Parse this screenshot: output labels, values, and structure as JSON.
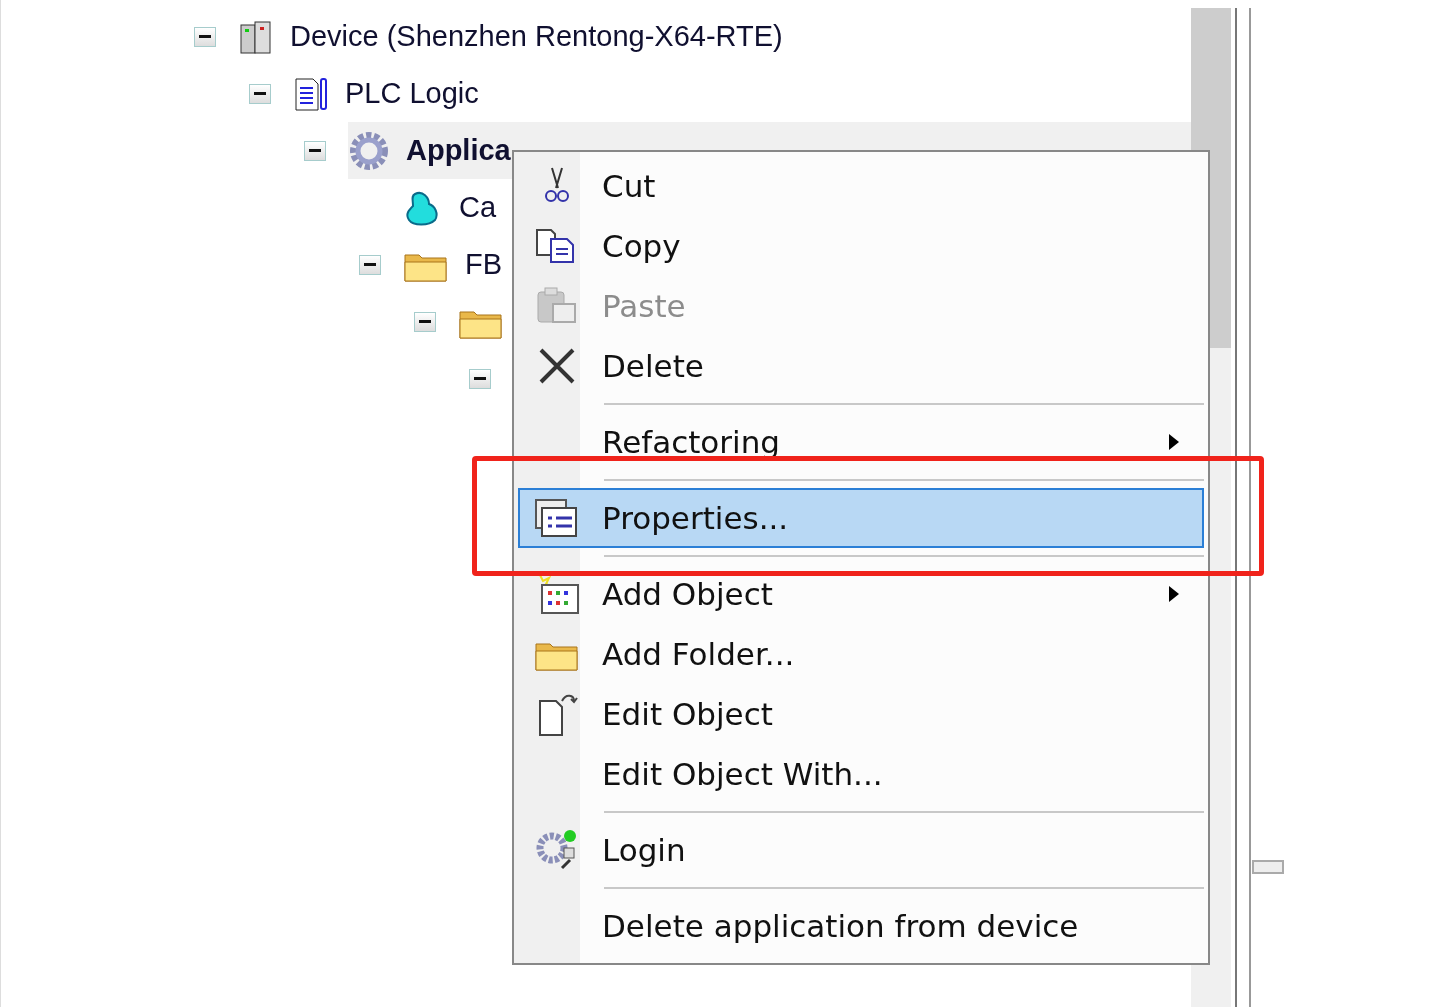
{
  "tree": [
    {
      "label": "Device (Shenzhen Rentong-X64-RTE)",
      "expanded": true,
      "selected": false,
      "children": [
        {
          "label": "PLC Logic",
          "expanded": true,
          "selected": false,
          "children": [
            {
              "label": "Applica",
              "expanded": true,
              "selected": true,
              "children": [
                {
                  "label": "Ca",
                  "selected": false
                },
                {
                  "label": "FB",
                  "expanded": true,
                  "selected": false,
                  "children": [
                    {
                      "expanded": true,
                      "selected": false,
                      "children": [
                        {
                          "expanded": true,
                          "selected": false
                        }
                      ]
                    }
                  ]
                }
              ]
            }
          ]
        }
      ]
    }
  ],
  "context_menu": {
    "items": [
      {
        "kind": "item",
        "label": "Cut",
        "disabled": false,
        "selected": false,
        "submenu": false
      },
      {
        "kind": "item",
        "label": "Copy",
        "disabled": false,
        "selected": false,
        "submenu": false
      },
      {
        "kind": "item",
        "label": "Paste",
        "disabled": true,
        "selected": false,
        "submenu": false
      },
      {
        "kind": "item",
        "label": "Delete",
        "disabled": false,
        "selected": false,
        "submenu": false
      },
      {
        "kind": "separator"
      },
      {
        "kind": "item",
        "label": "Refactoring",
        "disabled": false,
        "selected": false,
        "submenu": true
      },
      {
        "kind": "separator"
      },
      {
        "kind": "item",
        "label": "Properties...",
        "disabled": false,
        "selected": true,
        "submenu": false
      },
      {
        "kind": "separator"
      },
      {
        "kind": "item",
        "label": "Add Object",
        "disabled": false,
        "selected": false,
        "submenu": true
      },
      {
        "kind": "item",
        "label": "Add Folder...",
        "disabled": false,
        "selected": false,
        "submenu": false
      },
      {
        "kind": "item",
        "label": "Edit Object",
        "disabled": false,
        "selected": false,
        "submenu": false
      },
      {
        "kind": "item",
        "label": "Edit Object With...",
        "disabled": false,
        "selected": false,
        "submenu": false
      },
      {
        "kind": "separator"
      },
      {
        "kind": "item",
        "label": "Login",
        "disabled": false,
        "selected": false,
        "submenu": false
      },
      {
        "kind": "separator"
      },
      {
        "kind": "item",
        "label": "Delete application from device",
        "disabled": false,
        "selected": false,
        "submenu": false
      }
    ]
  }
}
